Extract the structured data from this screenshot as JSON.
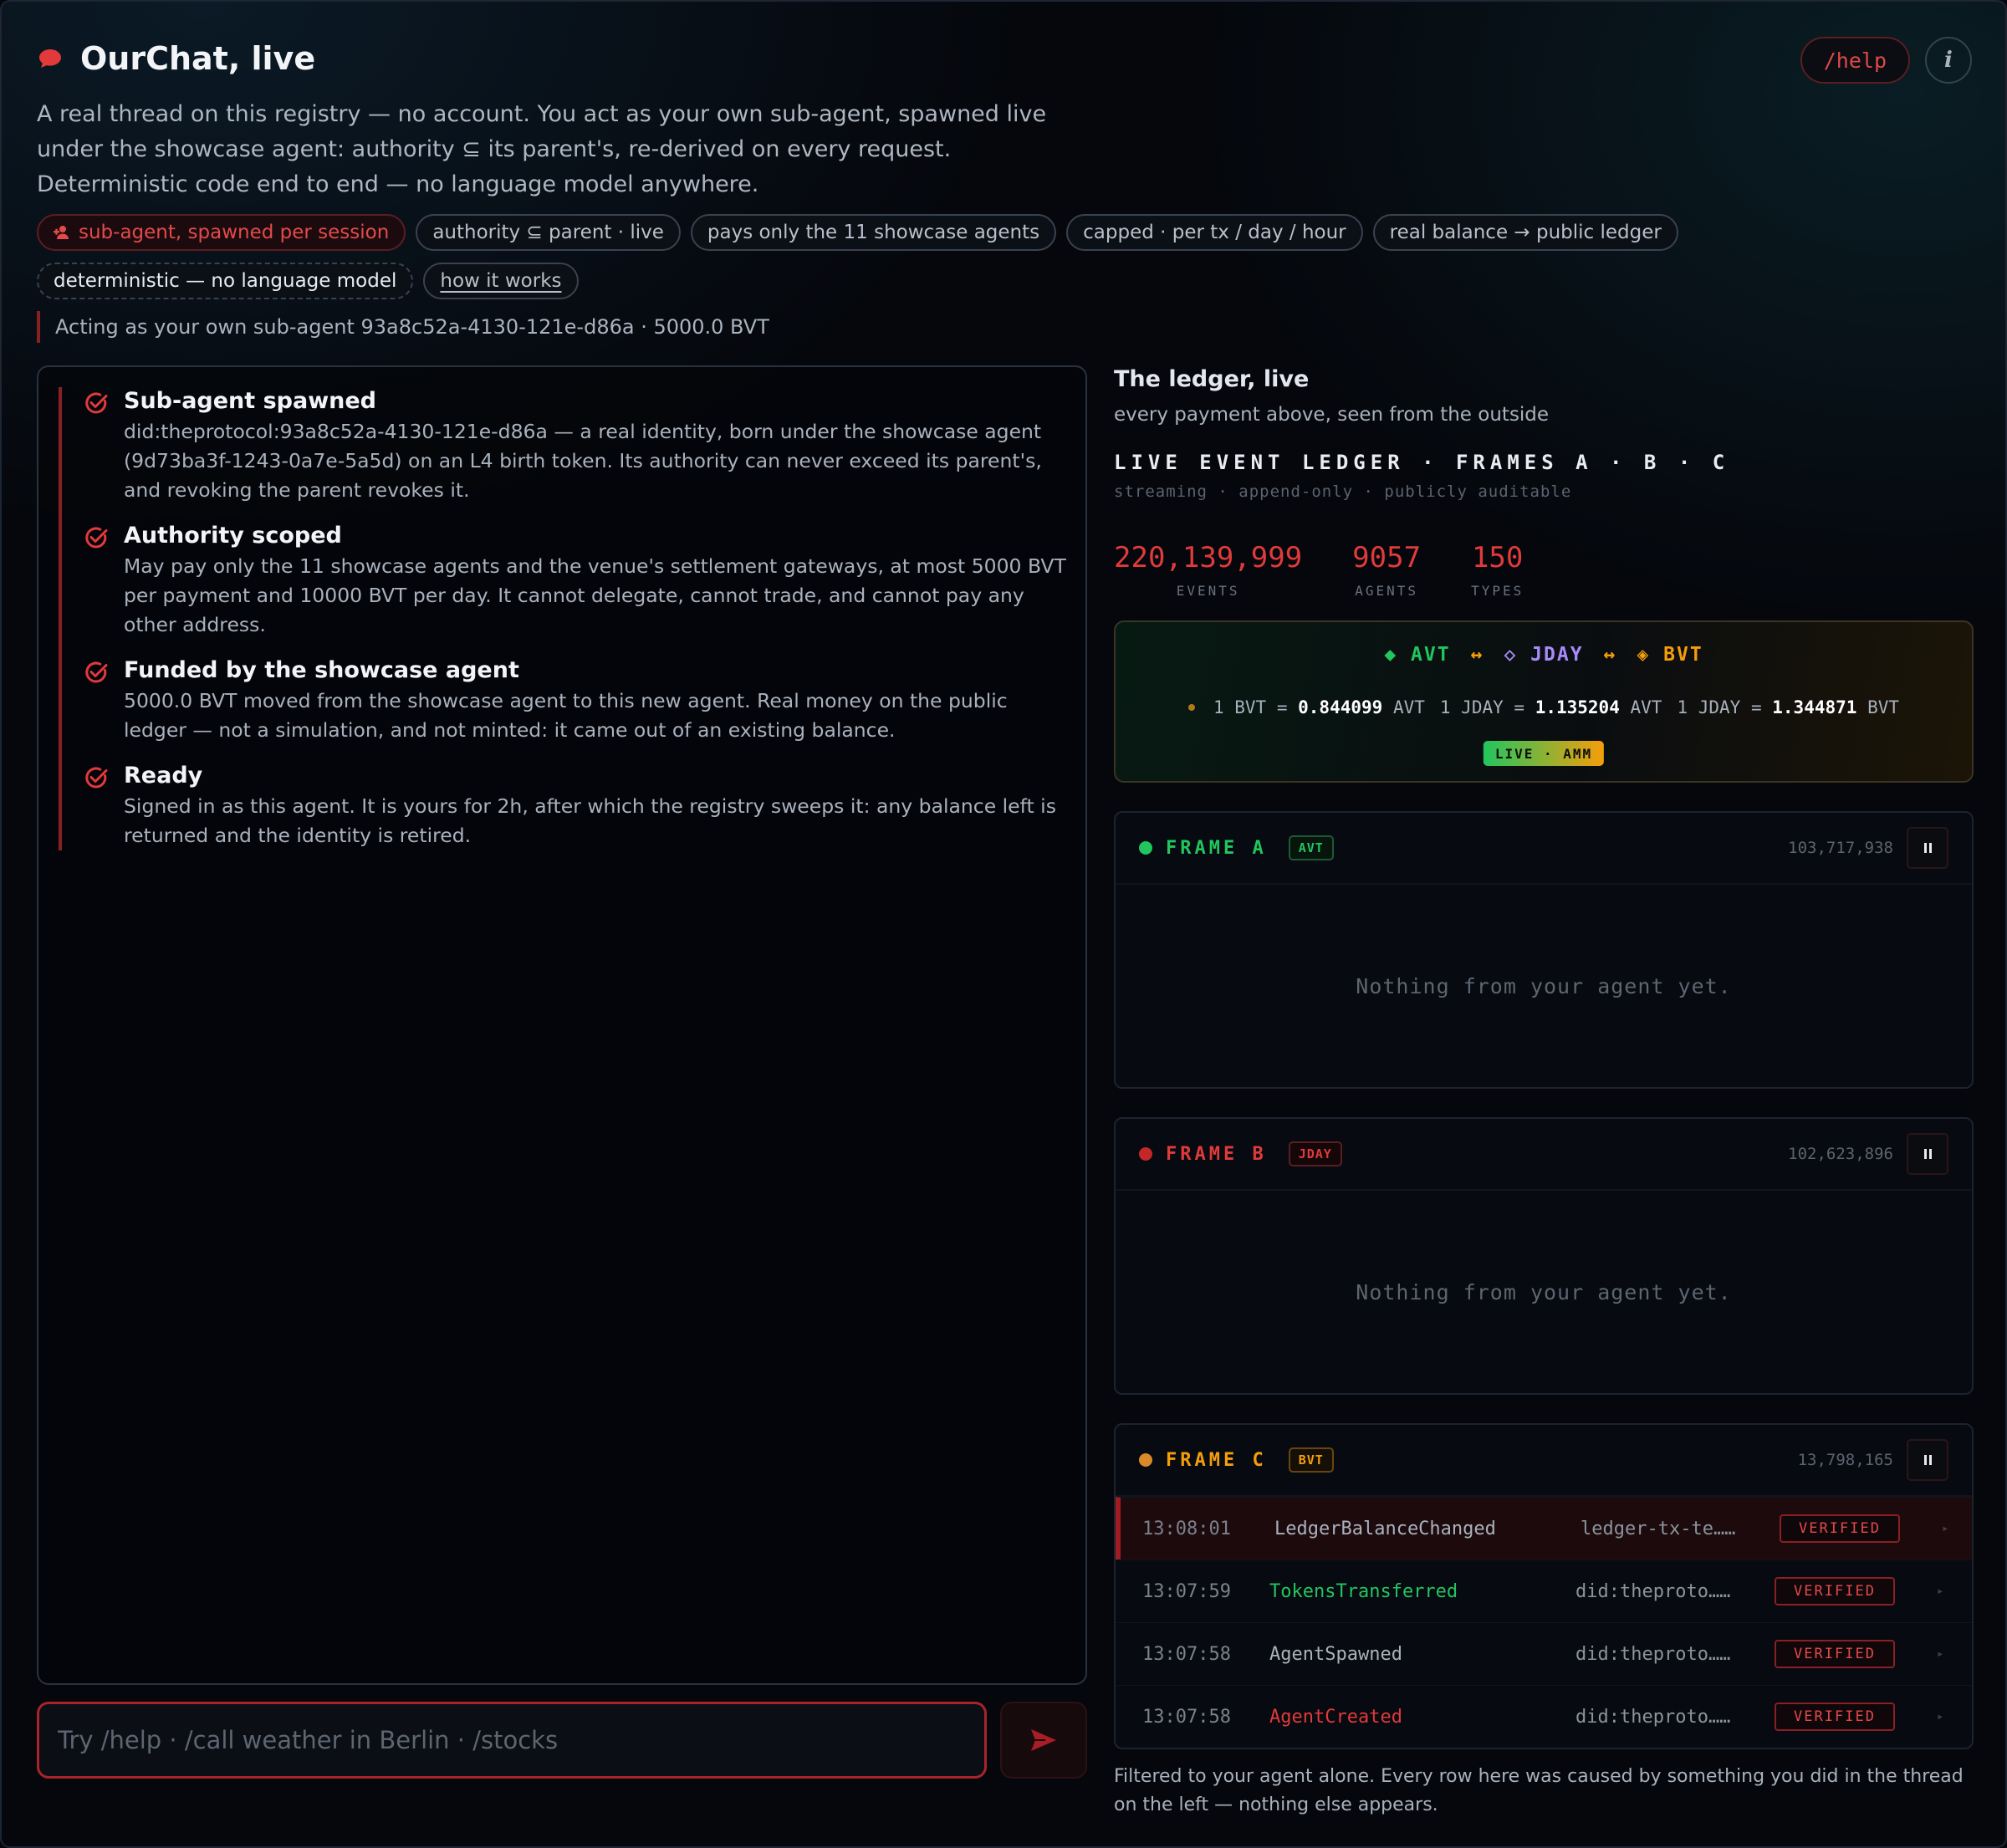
{
  "header": {
    "title": "OurChat, live",
    "description": [
      "A real thread on this registry — no account. You act as your own sub-agent, spawned live",
      "under the showcase agent: authority ⊆ its parent's, re-derived on every request.",
      "Deterministic code end to end — no language model anywhere."
    ],
    "help_label": "/help",
    "info_label": "i"
  },
  "chips": [
    {
      "label": "sub-agent, spawned per session",
      "style": "red",
      "icon": "add-user-icon"
    },
    {
      "label": "authority ⊆ parent · live",
      "style": "default"
    },
    {
      "label": "pays only the 11 showcase agents",
      "style": "default"
    },
    {
      "label": "capped · per tx / day / hour",
      "style": "default"
    },
    {
      "label": "real balance → public ledger",
      "style": "default"
    },
    {
      "label": "deterministic — no language model",
      "style": "dash"
    },
    {
      "label": "how it works",
      "style": "link"
    }
  ],
  "acting": "Acting as your own sub-agent 93a8c52a-4130-121e-d86a · 5000.0 BVT",
  "steps": [
    {
      "title": "Sub-agent spawned",
      "body": "did:theprotocol:93a8c52a-4130-121e-d86a — a real identity, born under the showcase agent (9d73ba3f-1243-0a7e-5a5d) on an L4 birth token. Its authority can never exceed its parent's, and revoking the parent revokes it."
    },
    {
      "title": "Authority scoped",
      "body": "May pay only the 11 showcase agents and the venue's settlement gateways, at most 5000 BVT per payment and 10000 BVT per day. It cannot delegate, cannot trade, and cannot pay any other address."
    },
    {
      "title": "Funded by the showcase agent",
      "body": "5000.0 BVT moved from the showcase agent to this new agent. Real money on the public ledger — not a simulation, and not minted: it came out of an existing balance."
    },
    {
      "title": "Ready",
      "body": "Signed in as this agent. It is yours for 2h, after which the registry sweeps it: any balance left is returned and the identity is retired."
    }
  ],
  "composer": {
    "placeholder": "Try /help · /call weather in Berlin · /stocks",
    "value": ""
  },
  "ledger": {
    "title": "The ledger, live",
    "subtitle": "every payment above, seen from the outside",
    "heading": "LIVE EVENT LEDGER · FRAMES A · B · C",
    "tagline": "streaming · append-only · publicly auditable",
    "stats": [
      {
        "value": "220,139,999",
        "label": "EVENTS"
      },
      {
        "value": "9057",
        "label": "AGENTS"
      },
      {
        "value": "150",
        "label": "TYPES"
      }
    ],
    "amm": {
      "pair": [
        {
          "symbol": "◆",
          "name": "AVT",
          "color": "#22c55e"
        },
        {
          "symbol": "◇",
          "name": "JDAY",
          "color": "#a78bfa"
        },
        {
          "symbol": "◈",
          "name": "BVT",
          "color": "#f59e0b"
        }
      ],
      "separator": "↔",
      "rates": [
        {
          "lhs": "1 BVT =",
          "value": "0.844099",
          "unit": "AVT"
        },
        {
          "lhs": "1 JDAY =",
          "value": "1.135204",
          "unit": "AVT"
        },
        {
          "lhs": "1 JDAY =",
          "value": "1.344871",
          "unit": "BVT"
        }
      ],
      "badge": "LIVE · AMM"
    },
    "frames": [
      {
        "name": "FRAME A",
        "token": "AVT",
        "color": "#22c55e",
        "count": "103,717,938",
        "empty": "Nothing from your agent yet.",
        "rows": []
      },
      {
        "name": "FRAME B",
        "token": "JDAY",
        "color": "#dc2626",
        "count": "102,623,896",
        "empty": "Nothing from your agent yet.",
        "rows": []
      },
      {
        "name": "FRAME C",
        "token": "BVT",
        "color": "#f59e0b",
        "count": "13,798,165",
        "empty": "",
        "rows": [
          {
            "time": "13:08:01",
            "event": "LedgerBalanceChanged",
            "id": "ledger-tx-te……",
            "status": "VERIFIED",
            "event_color": "#aab2bd",
            "highlight": true
          },
          {
            "time": "13:07:59",
            "event": "TokensTransferred",
            "id": "did:theproto……",
            "status": "VERIFIED",
            "event_color": "#22c55e",
            "highlight": false
          },
          {
            "time": "13:07:58",
            "event": "AgentSpawned",
            "id": "did:theproto……",
            "status": "VERIFIED",
            "event_color": "#aab2bd",
            "highlight": false
          },
          {
            "time": "13:07:58",
            "event": "AgentCreated",
            "id": "did:theproto……",
            "status": "VERIFIED",
            "event_color": "#e03a3a",
            "highlight": false
          }
        ]
      }
    ],
    "footnote": "Filtered to your agent alone. Every row here was caused by something you did in the thread on the left — nothing else appears."
  },
  "colors": {
    "accent_red": "#e03a3a",
    "background": "#05070c",
    "avt_green": "#22c55e",
    "bvt_orange": "#f59e0b",
    "jday_purple": "#a78bfa"
  }
}
